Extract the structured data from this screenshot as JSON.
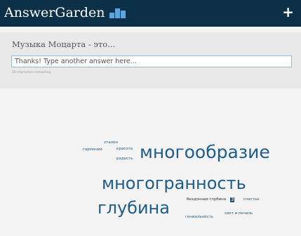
{
  "app": {
    "title": "AnswerGarden",
    "add_button": "+"
  },
  "question": {
    "text": "Музыка Моцарта - это..."
  },
  "answer_input": {
    "placeholder": "Thanks! Type another answer here..."
  },
  "remaining_text": "20 characters remaining",
  "cloud": {
    "words": [
      "эталон",
      "гармония",
      "красота",
      "радость",
      "многообразие",
      "многогранность",
      "бездонная глубина",
      "3",
      "счастье",
      "глубина",
      "гениальность",
      "свет и печаль"
    ]
  },
  "colors": {
    "topbar": "#0b3048",
    "word": "#1f5c8a",
    "panel": "#e9e9e9",
    "background": "#f3f3f3"
  }
}
